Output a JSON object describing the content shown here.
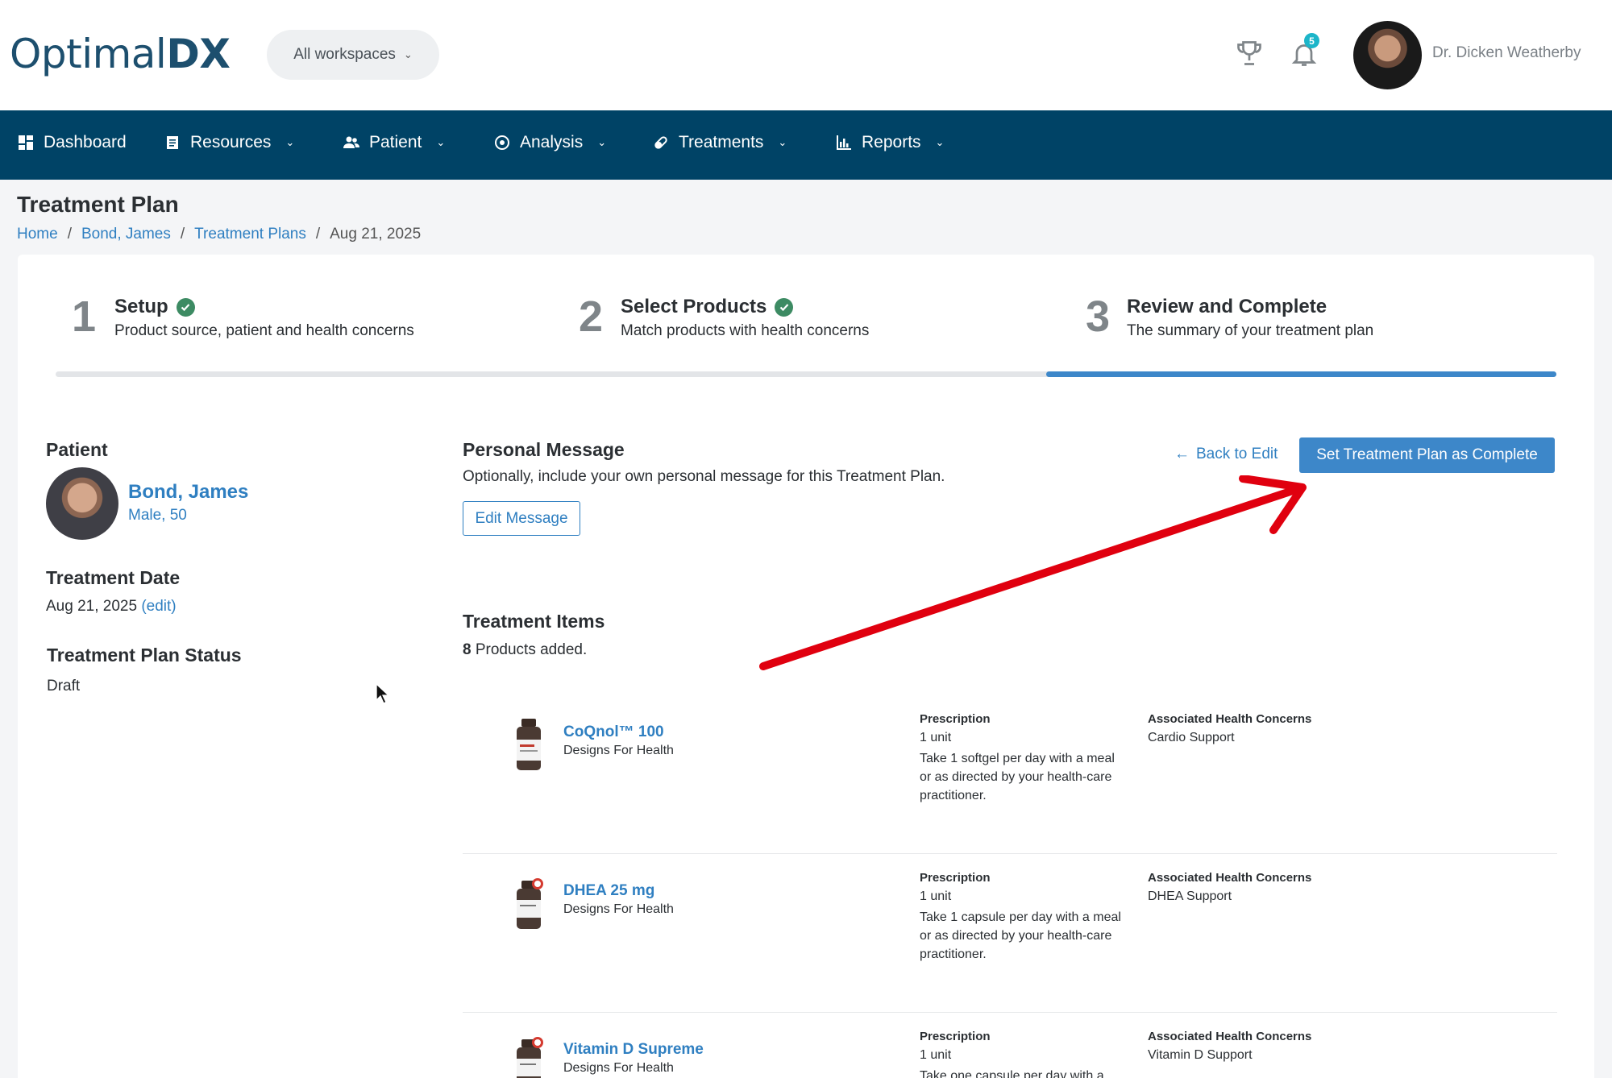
{
  "header": {
    "logo_text_a": "Optimal",
    "logo_text_b": "DX",
    "workspace_label": "All workspaces",
    "notifications_count": "5",
    "user_name": "Dr. Dicken Weatherby"
  },
  "nav": {
    "items": [
      {
        "label": "Dashboard",
        "icon": "dashboard-icon"
      },
      {
        "label": "Resources",
        "icon": "document-icon"
      },
      {
        "label": "Patient",
        "icon": "users-icon"
      },
      {
        "label": "Analysis",
        "icon": "target-icon"
      },
      {
        "label": "Treatments",
        "icon": "pill-icon"
      },
      {
        "label": "Reports",
        "icon": "bar-chart-icon"
      }
    ]
  },
  "page": {
    "title": "Treatment Plan",
    "breadcrumb": [
      "Home",
      "Bond, James",
      "Treatment Plans",
      "Aug 21, 2025"
    ]
  },
  "steps": [
    {
      "num": "1",
      "title": "Setup",
      "desc": "Product source, patient and health concerns",
      "done": true
    },
    {
      "num": "2",
      "title": "Select Products",
      "desc": "Match products with health concerns",
      "done": true
    },
    {
      "num": "3",
      "title": "Review and Complete",
      "desc": "The summary of your treatment plan",
      "done": false
    }
  ],
  "progress": {
    "current_step": 3,
    "total_steps": 3
  },
  "patient": {
    "heading": "Patient",
    "name": "Bond, James",
    "meta": "Male, 50"
  },
  "treatment_date": {
    "heading": "Treatment Date",
    "value": "Aug 21, 2025",
    "edit_label": "(edit)"
  },
  "status": {
    "heading": "Treatment Plan Status",
    "value": "Draft"
  },
  "personal_message": {
    "heading": "Personal Message",
    "desc": "Optionally, include your own personal message for this Treatment Plan.",
    "edit_button": "Edit Message"
  },
  "actions": {
    "back_label": "Back to Edit",
    "complete_label": "Set Treatment Plan as Complete"
  },
  "treatment_items": {
    "heading": "Treatment Items",
    "count": "8",
    "count_suffix": "Products added.",
    "rx_heading": "Prescription",
    "hc_heading": "Associated Health Concerns",
    "items": [
      {
        "name": "CoQnol™ 100",
        "brand": "Designs For Health",
        "qty": "1 unit",
        "rx": "Take 1 softgel per day with a meal or as directed by your health-care practitioner.",
        "concern": "Cardio Support"
      },
      {
        "name": "DHEA 25 mg",
        "brand": "Designs For Health",
        "qty": "1 unit",
        "rx": "Take 1 capsule per day with a meal or as directed by your health-care practitioner.",
        "concern": "DHEA Support"
      },
      {
        "name": "Vitamin D Supreme",
        "brand": "Designs For Health",
        "qty": "1 unit",
        "rx": "Take one capsule per day with a",
        "concern": "Vitamin D Support"
      }
    ]
  },
  "colors": {
    "nav_bg": "#004366",
    "link": "#2f7fc1",
    "primary_button": "#3d87c9",
    "check": "#3d8b63",
    "badge": "#1cb5c9",
    "annotation_arrow": "#e0000f"
  }
}
